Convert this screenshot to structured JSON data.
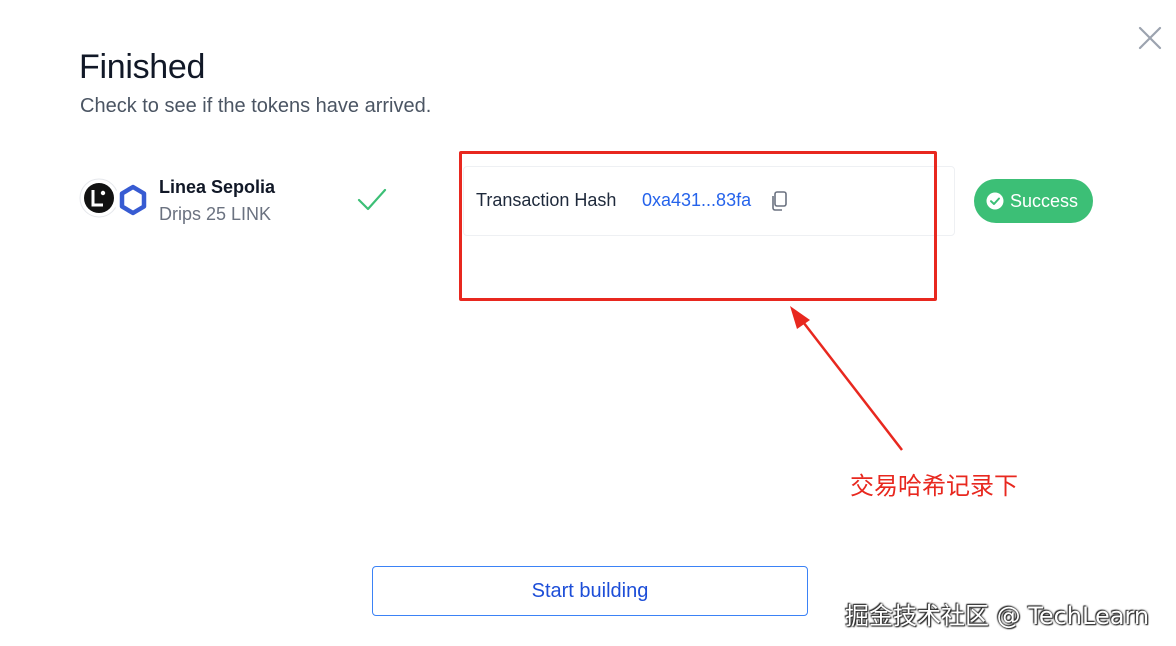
{
  "dialog": {
    "title": "Finished",
    "subtitle": "Check to see if the tokens have arrived."
  },
  "network": {
    "name": "Linea Sepolia",
    "drip": "Drips 25 LINK",
    "icons": [
      "linea-logo",
      "chainlink-logo"
    ]
  },
  "transaction": {
    "label": "Transaction Hash",
    "hash": "0xa431...83fa"
  },
  "status": {
    "label": "Success",
    "color": "#3cbf76"
  },
  "annotation": {
    "text": "交易哈希记录下",
    "color": "#e8281f"
  },
  "actions": {
    "start_building": "Start building"
  },
  "watermark": "掘金技术社区 @ TechLearn"
}
